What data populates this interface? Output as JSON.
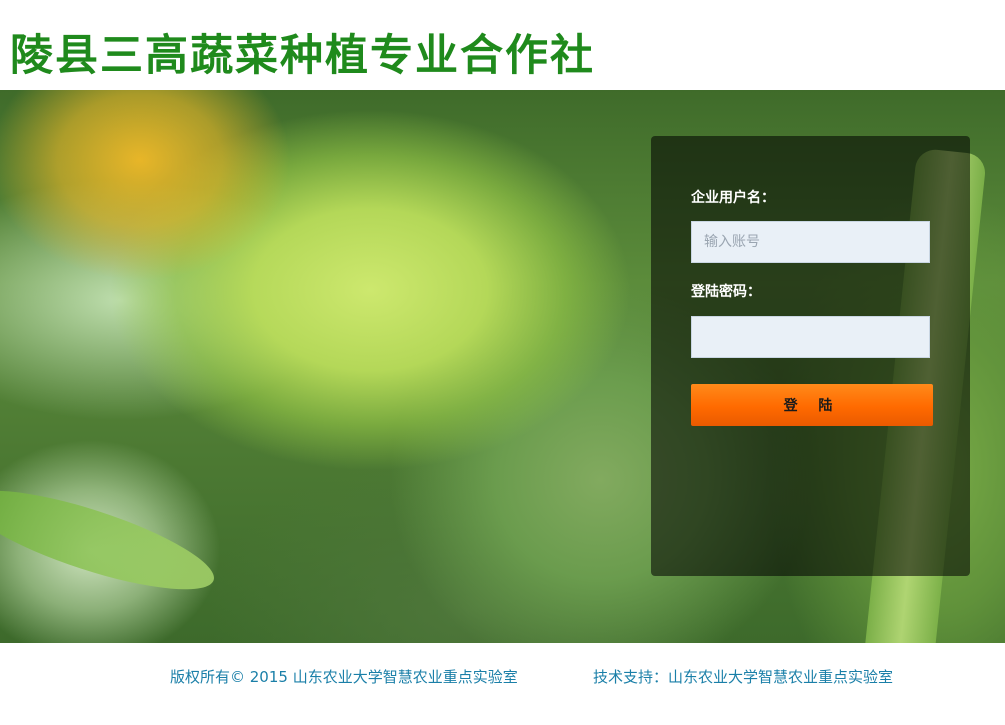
{
  "header": {
    "title": "陵县三高蔬菜种植专业合作社"
  },
  "login": {
    "username_label": "企业用户名：",
    "username_placeholder": "输入账号",
    "username_value": "",
    "password_label": "登陆密码：",
    "password_value": "",
    "submit_label": "登 陆"
  },
  "footer": {
    "copyright": "版权所有© 2015 山东农业大学智慧农业重点实验室",
    "support": "技术支持：山东农业大学智慧农业重点实验室"
  },
  "colors": {
    "title_green": "#1f8a1c",
    "button_orange": "#ff6a00",
    "footer_link_blue": "#1a7fa8"
  }
}
